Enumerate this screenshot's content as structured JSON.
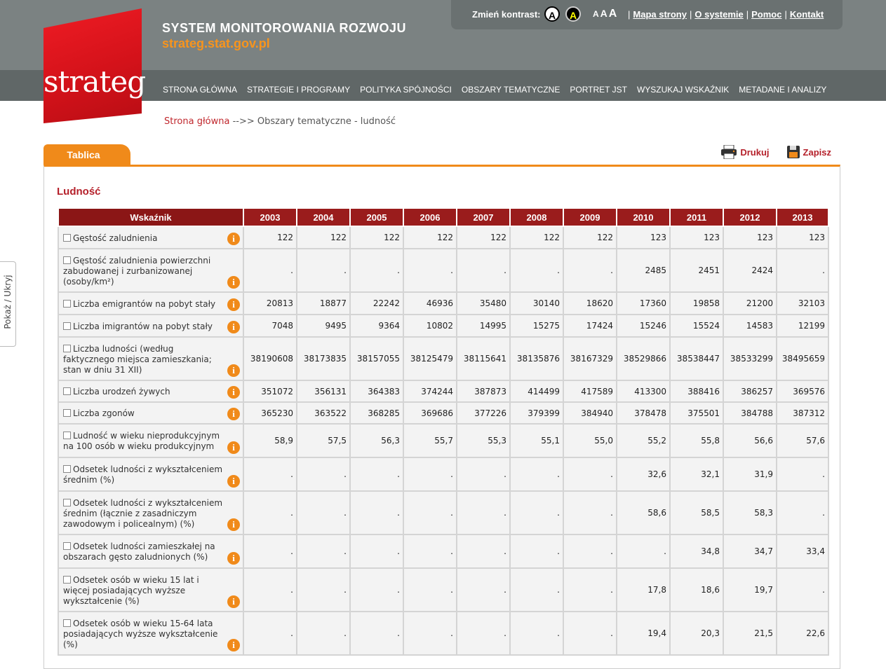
{
  "site": {
    "title": "SYSTEM MONITOROWANIA ROZWOJU",
    "url": "strateg.stat.gov.pl",
    "logo_text": "strateg"
  },
  "toolbox": {
    "contrast_label": "Zmień kontrast:",
    "contrast_normal": "A",
    "contrast_high": "A",
    "font_sizes": [
      "A",
      "A",
      "A"
    ],
    "links": [
      "Mapa strony",
      "O systemie",
      "Pomoc",
      "Kontakt"
    ]
  },
  "nav": [
    "STRONA GŁÓWNA",
    "STRATEGIE I PROGRAMY",
    "POLITYKA SPÓJNOŚCI",
    "OBSZARY TEMATYCZNE",
    "PORTRET JST",
    "WYSZUKAJ WSKAŹNIK",
    "METADANE I ANALIZY"
  ],
  "breadcrumb": {
    "home": "Strona główna",
    "sep": "-->>",
    "current": "Obszary tematyczne - ludność"
  },
  "tab": "Tablica",
  "actions": {
    "print": "Drukuj",
    "save": "Zapisz"
  },
  "heading": "Ludność",
  "side_toggle": "Pokaż / Ukryj",
  "table": {
    "header": "Wskaźnik",
    "years": [
      "2003",
      "2004",
      "2005",
      "2006",
      "2007",
      "2008",
      "2009",
      "2010",
      "2011",
      "2012",
      "2013"
    ],
    "rows": [
      {
        "name": "Gęstość zaludnienia",
        "values": [
          "122",
          "122",
          "122",
          "122",
          "122",
          "122",
          "122",
          "123",
          "123",
          "123",
          "123"
        ]
      },
      {
        "name": "Gęstość zaludnienia powierzchni zabudowanej i zurbanizowanej (osoby/km²)",
        "values": [
          ".",
          ".",
          ".",
          ".",
          ".",
          ".",
          ".",
          "2485",
          "2451",
          "2424",
          "."
        ]
      },
      {
        "name": "Liczba emigrantów na pobyt stały",
        "values": [
          "20813",
          "18877",
          "22242",
          "46936",
          "35480",
          "30140",
          "18620",
          "17360",
          "19858",
          "21200",
          "32103"
        ]
      },
      {
        "name": "Liczba imigrantów na pobyt stały",
        "values": [
          "7048",
          "9495",
          "9364",
          "10802",
          "14995",
          "15275",
          "17424",
          "15246",
          "15524",
          "14583",
          "12199"
        ]
      },
      {
        "name": "Liczba ludności (według faktycznego miejsca zamieszkania; stan w dniu 31 XII)",
        "values": [
          "38190608",
          "38173835",
          "38157055",
          "38125479",
          "38115641",
          "38135876",
          "38167329",
          "38529866",
          "38538447",
          "38533299",
          "38495659"
        ]
      },
      {
        "name": "Liczba urodzeń żywych",
        "values": [
          "351072",
          "356131",
          "364383",
          "374244",
          "387873",
          "414499",
          "417589",
          "413300",
          "388416",
          "386257",
          "369576"
        ]
      },
      {
        "name": "Liczba zgonów",
        "values": [
          "365230",
          "363522",
          "368285",
          "369686",
          "377226",
          "379399",
          "384940",
          "378478",
          "375501",
          "384788",
          "387312"
        ]
      },
      {
        "name": "Ludność w wieku nieprodukcyjnym na 100 osób w wieku produkcyjnym",
        "values": [
          "58,9",
          "57,5",
          "56,3",
          "55,7",
          "55,3",
          "55,1",
          "55,0",
          "55,2",
          "55,8",
          "56,6",
          "57,6"
        ]
      },
      {
        "name": "Odsetek ludności z wykształceniem średnim (%)",
        "values": [
          ".",
          ".",
          ".",
          ".",
          ".",
          ".",
          ".",
          "32,6",
          "32,1",
          "31,9",
          "."
        ]
      },
      {
        "name": "Odsetek ludności z wykształceniem średnim (łącznie z zasadniczym zawodowym i policealnym) (%)",
        "values": [
          ".",
          ".",
          ".",
          ".",
          ".",
          ".",
          ".",
          "58,6",
          "58,5",
          "58,3",
          "."
        ]
      },
      {
        "name": "Odsetek ludności zamieszkałej na obszarach gęsto zaludnionych (%)",
        "values": [
          ".",
          ".",
          ".",
          ".",
          ".",
          ".",
          ".",
          ".",
          "34,8",
          "34,7",
          "33,4"
        ]
      },
      {
        "name": "Odsetek osób w wieku 15 lat i więcej posiadających wyższe wykształcenie (%)",
        "values": [
          ".",
          ".",
          ".",
          ".",
          ".",
          ".",
          ".",
          "17,8",
          "18,6",
          "19,7",
          "."
        ]
      },
      {
        "name": "Odsetek osób w wieku 15-64 lata posiadających wyższe wykształcenie (%)",
        "values": [
          ".",
          ".",
          ".",
          ".",
          ".",
          ".",
          ".",
          "19,4",
          "20,3",
          "21,5",
          "22,6"
        ]
      }
    ]
  }
}
